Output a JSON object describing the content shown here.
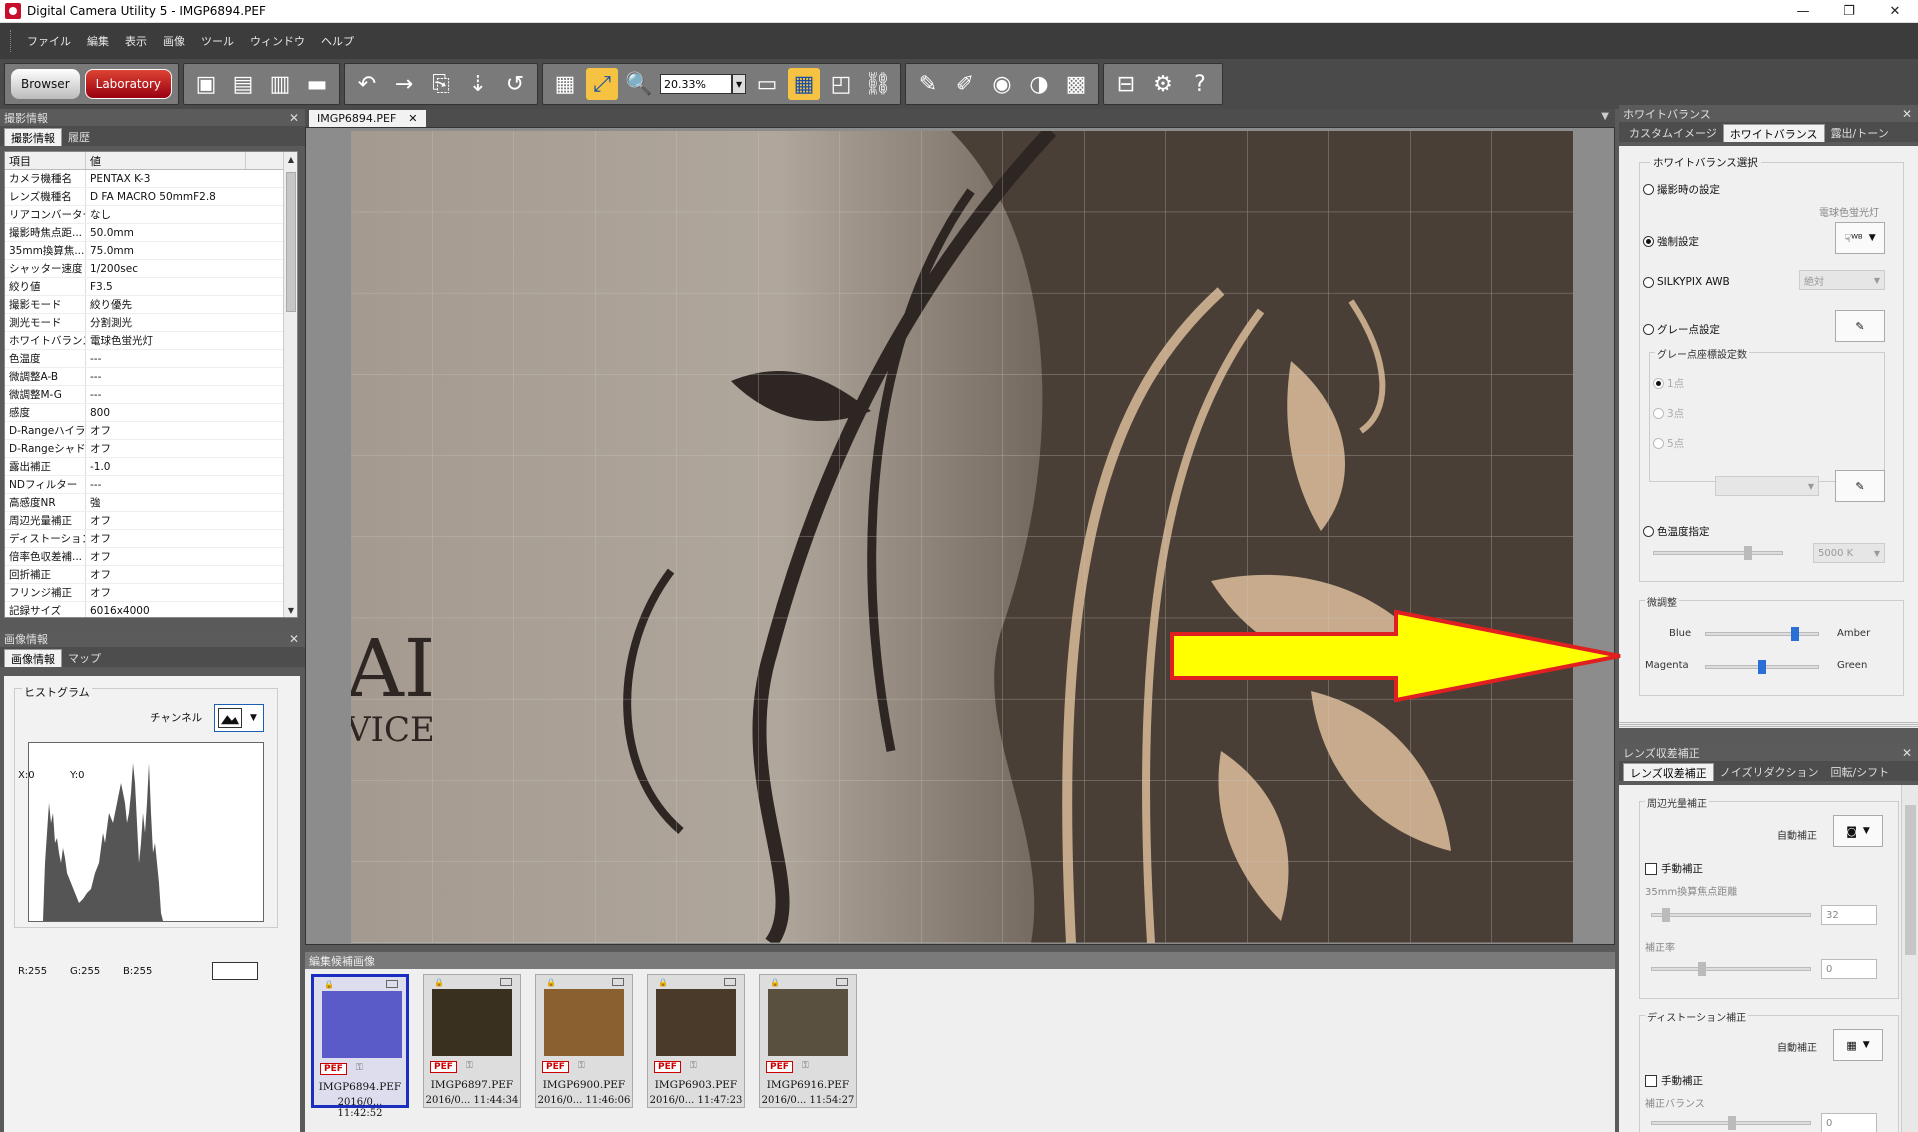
{
  "window": {
    "title": "Digital Camera Utility 5 - IMGP6894.PEF",
    "controls": [
      "—",
      "❐",
      "✕"
    ]
  },
  "menu": [
    "ファイル",
    "編集",
    "表示",
    "画像",
    "ツール",
    "ウィンドウ",
    "ヘルプ"
  ],
  "toolbar": {
    "browser_label": "Browser",
    "laboratory_label": "Laboratory",
    "zoom_value": "20.33%"
  },
  "shooting_panel": {
    "title": "撮影情報",
    "tabs": [
      "撮影情報",
      "履歴"
    ],
    "headers": [
      "項目",
      "値"
    ],
    "rows": [
      [
        "カメラ機種名",
        "PENTAX K-3"
      ],
      [
        "レンズ機種名",
        "D FA MACRO 50mmF2.8"
      ],
      [
        "リアコンバーター",
        "なし"
      ],
      [
        "撮影時焦点距...",
        "50.0mm"
      ],
      [
        "35mm換算焦...",
        "75.0mm"
      ],
      [
        "シャッター速度",
        "1/200sec"
      ],
      [
        "絞り値",
        "F3.5"
      ],
      [
        "撮影モード",
        "絞り優先"
      ],
      [
        "測光モード",
        "分割測光"
      ],
      [
        "ホワイトバランス",
        "電球色蛍光灯"
      ],
      [
        "色温度",
        "---"
      ],
      [
        "微調整A-B",
        "---"
      ],
      [
        "微調整M-G",
        "---"
      ],
      [
        "感度",
        "800"
      ],
      [
        "D-Rangeハイラ...",
        "オフ"
      ],
      [
        "D-Rangeシャド...",
        "オフ"
      ],
      [
        "露出補正",
        "-1.0"
      ],
      [
        "NDフィルター",
        "---"
      ],
      [
        "高感度NR",
        "強"
      ],
      [
        "周辺光量補正",
        "オフ"
      ],
      [
        "ディストーション...",
        "オフ"
      ],
      [
        "倍率色収差補...",
        "オフ"
      ],
      [
        "回折補正",
        "オフ"
      ],
      [
        "フリンジ補正",
        "オフ"
      ],
      [
        "記録サイズ",
        "6016x4000"
      ]
    ]
  },
  "image_panel": {
    "title": "画像情報",
    "tabs": [
      "画像情報",
      "マップ"
    ],
    "histogram_label": "ヒストグラム",
    "channel_label": "チャンネル",
    "x_readout": "X:0",
    "y_readout": "Y:0",
    "r_readout": "R:255",
    "g_readout": "G:255",
    "b_readout": "B:255"
  },
  "document_tab": {
    "label": "IMGP6894.PEF"
  },
  "thumbnails": {
    "title": "編集候補画像",
    "items": [
      {
        "name": "IMGP6894.PEF",
        "date": "2016/0...  11:42:52",
        "badge": "PEF",
        "color": "#5a5ac8"
      },
      {
        "name": "IMGP6897.PEF",
        "date": "2016/0...  11:44:34",
        "badge": "PEF",
        "color": "#3a3020"
      },
      {
        "name": "IMGP6900.PEF",
        "date": "2016/0...  11:46:06",
        "badge": "PEF",
        "color": "#8a6030"
      },
      {
        "name": "IMGP6903.PEF",
        "date": "2016/0...  11:47:23",
        "badge": "PEF",
        "color": "#4a3a2a"
      },
      {
        "name": "IMGP6916.PEF",
        "date": "2016/0...  11:54:27",
        "badge": "PEF",
        "color": "#5a5040"
      }
    ]
  },
  "wb_panel": {
    "title": "ホワイトバランス",
    "tabs": [
      "カスタムイメージ",
      "ホワイトバランス",
      "露出/トーン"
    ],
    "group_label": "ホワイトバランス選択",
    "opt_shoot": "撮影時の設定",
    "preset_label": "電球色蛍光灯",
    "opt_force": "強制設定",
    "opt_silky": "SILKYPIX AWB",
    "silky_value": "絶対",
    "opt_gray": "グレー点設定",
    "gray_count_label": "グレー点座標設定数",
    "gray_1": "1点",
    "gray_3": "3点",
    "gray_5": "5点",
    "opt_temp": "色温度指定",
    "temp_value": "5000 K",
    "fine_label": "微調整",
    "blue": "Blue",
    "amber": "Amber",
    "magenta": "Magenta",
    "green": "Green",
    "ab_level": 0.82,
    "mg_level": 0.5
  },
  "lens_panel": {
    "title": "レンズ収差補正",
    "tabs": [
      "レンズ収差補正",
      "ノイズリダクション",
      "回転/シフト"
    ],
    "vignette_label": "周辺光量補正",
    "vignette_auto": "自動補正",
    "vignette_manual": "手動補正",
    "focal_label": "35mm換算焦点距離",
    "focal_value": "32",
    "amount_label": "補正率",
    "amount_value": "0",
    "distortion_label": "ディストーション補正",
    "distortion_auto": "自動補正",
    "distortion_manual": "手動補正",
    "balance_label": "補正バランス",
    "balance_value": "0"
  }
}
